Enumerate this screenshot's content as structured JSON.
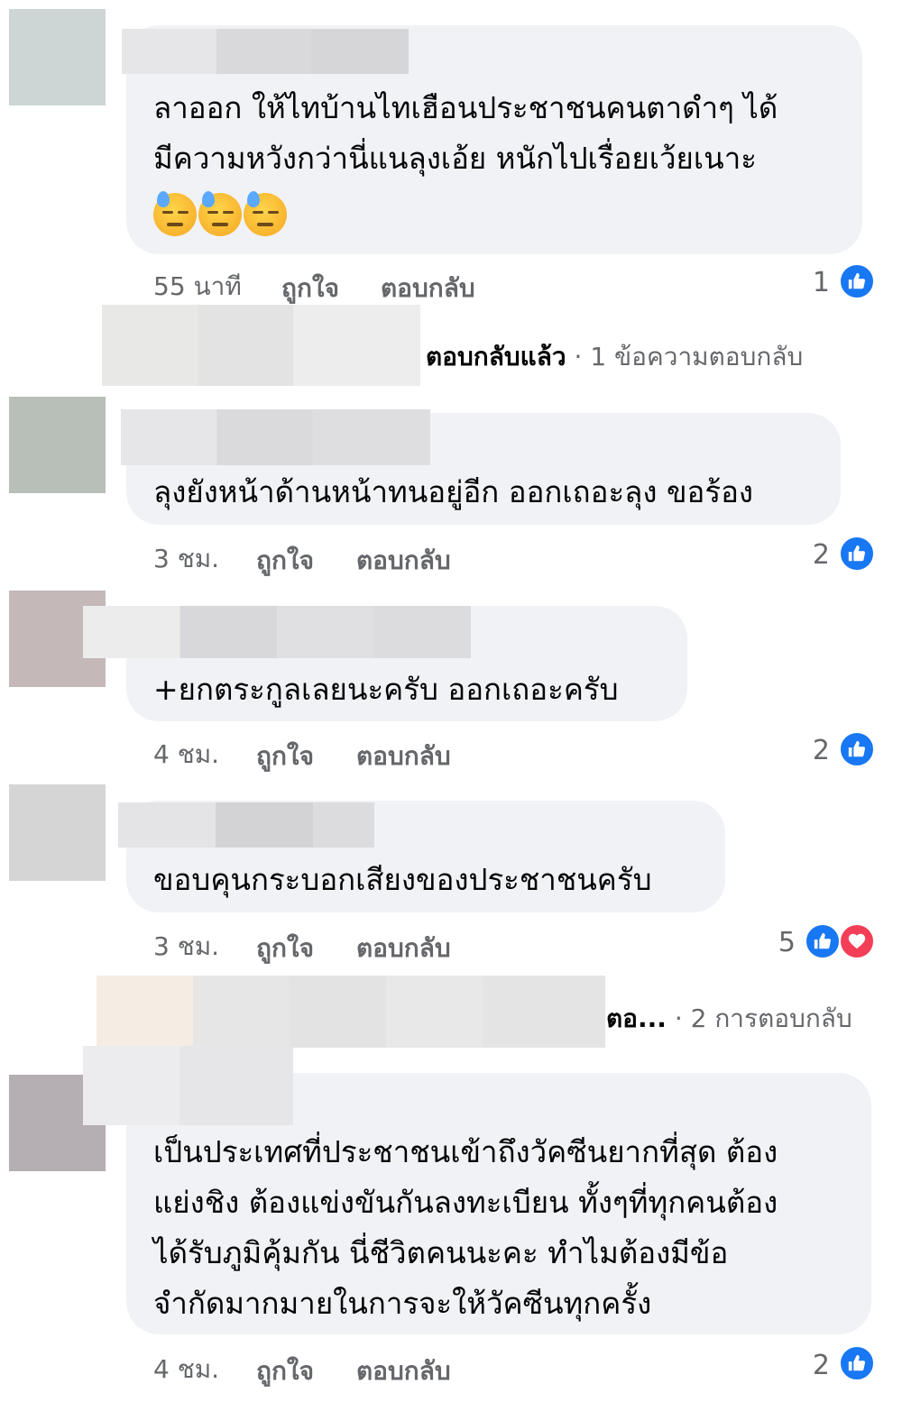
{
  "colors": {
    "bubble": "#f0f2f5",
    "meta_text": "#65676b",
    "like_blue": "#1877f2",
    "love_red": "#f33e58"
  },
  "comments": [
    {
      "text_lines": [
        "ลาออก ให้ไทบ้านไทเฮือนประชาชนคนตาดำๆ ได้",
        "มีความหวังกว่านี่แนลุงเอ้ย หนักไปเรื่อยเว้ยเนาะ"
      ],
      "emoji": "downcast-sweat-emoji",
      "time": "55 นาที",
      "like_label": "ถูกใจ",
      "reply_label": "ตอบกลับ",
      "reaction_count": "1"
    },
    {
      "text_lines": [
        "ลุงยังหน้าด้านหน้าทนอยู่อีก ออกเถอะลุง ขอร้อง"
      ],
      "time": "3 ชม.",
      "like_label": "ถูกใจ",
      "reply_label": "ตอบกลับ",
      "reaction_count": "2"
    },
    {
      "text_lines": [
        "+ยกตระกูลเลยนะครับ ออกเถอะครับ"
      ],
      "time": "4 ชม.",
      "like_label": "ถูกใจ",
      "reply_label": "ตอบกลับ",
      "reaction_count": "2"
    },
    {
      "text_lines": [
        "ขอบคุนกระบอกเสียงของประชาชนครับ"
      ],
      "time": "3 ชม.",
      "like_label": "ถูกใจ",
      "reply_label": "ตอบกลับ",
      "reaction_count": "5"
    },
    {
      "text_lines": [
        "เป็นประเทศที่ประชาชนเข้าถึงวัคซีนยากที่สุด ต้อง",
        "แย่งชิง ต้องแข่งขันกันลงทะเบียน ทั้งๆที่ทุกคนต้อง",
        "ได้รับภูมิคุ้มกัน นี่ชีวิตคนนะคะ ทำไมต้องมีข้อ",
        "จำกัดมากมายในการจะให้วัคซีนทุกครั้ง"
      ],
      "time": "4 ชม.",
      "like_label": "ถูกใจ",
      "reply_label": "ตอบกลับ",
      "reaction_count": "2"
    }
  ],
  "reply_threads": [
    {
      "label": "ตอบกลับแล้ว",
      "separator": "·",
      "count_text": "1 ข้อความตอบกลับ"
    },
    {
      "label": "ตอ...",
      "separator": "·",
      "count_text": "2 การตอบกลับ"
    }
  ]
}
